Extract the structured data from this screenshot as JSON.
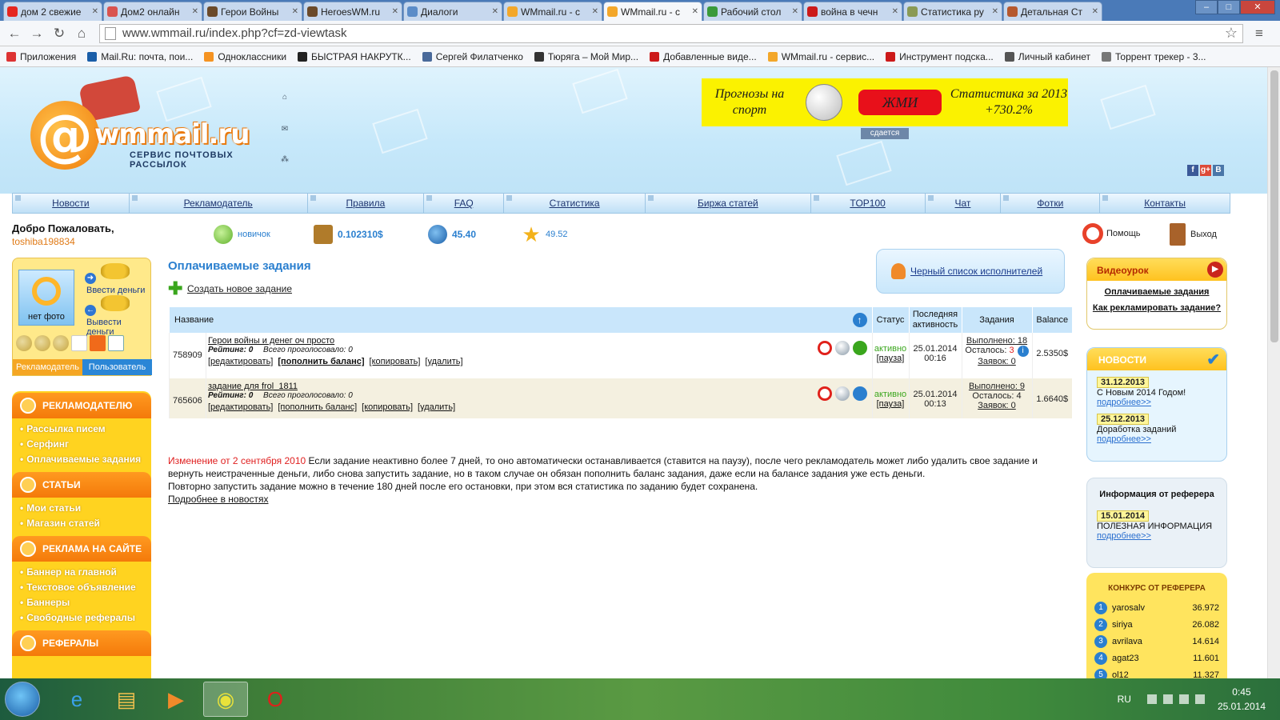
{
  "browser": {
    "tabs": [
      {
        "title": "дом 2 свежие",
        "color": "#e52620"
      },
      {
        "title": "Дом2 онлайн",
        "color": "#d9534f"
      },
      {
        "title": "Герои Войны",
        "color": "#6b4a2a"
      },
      {
        "title": "HeroesWM.ru",
        "color": "#6b4a2a"
      },
      {
        "title": "Диалоги",
        "color": "#5b8cc8"
      },
      {
        "title": "WMmail.ru - с",
        "color": "#f3a72a"
      },
      {
        "title": "WMmail.ru - с",
        "color": "#f3a72a",
        "active": true
      },
      {
        "title": "Рабочий стол",
        "color": "#3a9a3a"
      },
      {
        "title": "война в чечн",
        "color": "#cc1a1a"
      },
      {
        "title": "Статистика ру",
        "color": "#8a9a55"
      },
      {
        "title": "Детальная Ст",
        "color": "#b5582e"
      }
    ],
    "window_controls": {
      "minimize": "–",
      "maximize": "□",
      "close": "✕"
    },
    "nav_icons": {
      "back": "←",
      "forward": "→",
      "reload": "↻",
      "home": "⌂",
      "star": "☆",
      "menu": "≡"
    },
    "url": "www.wmmail.ru/index.php?cf=zd-viewtask",
    "bookmarks": [
      {
        "label": "Приложения",
        "color": "#d33"
      },
      {
        "label": "Mail.Ru: почта, пои...",
        "color": "#1a5ea8"
      },
      {
        "label": "Одноклассники",
        "color": "#f59322"
      },
      {
        "label": "БЫСТРАЯ НАКРУТК...",
        "color": "#222"
      },
      {
        "label": "Сергей Филатченко",
        "color": "#4a6a9a"
      },
      {
        "label": "Тюряга – Мой Мир...",
        "color": "#333"
      },
      {
        "label": "Добавленные виде...",
        "color": "#cc1a1a"
      },
      {
        "label": "WMmail.ru - сервис...",
        "color": "#f3a72a"
      },
      {
        "label": "Инструмент подска...",
        "color": "#cc1a1a"
      },
      {
        "label": "Личный кабинет",
        "color": "#555"
      },
      {
        "label": "Торрент трекер - 3...",
        "color": "#777"
      }
    ]
  },
  "header": {
    "logo_at": "@",
    "logo_name": "wmmail.ru",
    "logo_sub": "СЕРВИС ПОЧТОВЫХ РАССЫЛОК",
    "banner_left": "Прогнозы на спорт",
    "banner_button": "ЖМИ",
    "banner_right": "Статистика за 2013 +730.2%",
    "rent_label": "сдается",
    "social": [
      {
        "name": "facebook",
        "glyph": "f",
        "color": "#3b5998"
      },
      {
        "name": "google-plus",
        "glyph": "g+",
        "color": "#dd4b39"
      },
      {
        "name": "vkontakte",
        "glyph": "B",
        "color": "#4a76a8"
      }
    ]
  },
  "nav": [
    {
      "label": "Новости",
      "w": 146
    },
    {
      "label": "Рекламодатель",
      "w": 223
    },
    {
      "label": "Правила",
      "w": 146
    },
    {
      "label": "FAQ",
      "w": 100
    },
    {
      "label": "Статистика",
      "w": 177
    },
    {
      "label": "Биржа статей",
      "w": 207
    },
    {
      "label": "TOP100",
      "w": 143
    },
    {
      "label": "Чат",
      "w": 95
    },
    {
      "label": "Фотки",
      "w": 124
    },
    {
      "label": "Контакты",
      "w": 162
    }
  ],
  "user": {
    "welcome": "Добро Пожаловать,",
    "username": "toshiba198834",
    "level": "новичок",
    "balance": "0.102310$",
    "credit": "45.40",
    "rating": "49.52",
    "help": "Помощь",
    "logout": "Выход"
  },
  "profile": {
    "photo_label": "нет фото",
    "deposit": "Ввести деньги",
    "withdraw": "Вывести деньги",
    "role_advertiser": "Рекламодатель",
    "role_user": "Пользователь"
  },
  "left_menu": [
    {
      "title": "РЕКЛАМОДАТЕЛЮ",
      "items": [
        "Рассылка писем",
        "Серфинг",
        "Оплачиваемые задания"
      ]
    },
    {
      "title": "СТАТЬИ",
      "items": [
        "Мои статьи",
        "Магазин статей"
      ]
    },
    {
      "title": "РЕКЛАМА НА САЙТЕ",
      "items": [
        "Баннер на главной",
        "Текстовое объявление",
        "Баннеры",
        "Свободные рефералы"
      ]
    },
    {
      "title": "РЕФЕРАЛЫ",
      "items": []
    }
  ],
  "main": {
    "title": "Оплачиваемые задания",
    "create": "Создать новое задание",
    "blacklist": "Черный список исполнителей",
    "table": {
      "headers": {
        "name": "Название",
        "status": "Статус",
        "activity": "Последняя активность",
        "tasks": "Задания",
        "balance": "Balance"
      },
      "rows": [
        {
          "id": "758909",
          "name": "Герои войны и денег оч просто",
          "rating_label": "Рейтинг:",
          "rating": "0",
          "votes": "Всего проголосовало: 0",
          "actions": [
            "[редактировать]",
            "[пополнить баланс]",
            "[копировать]",
            "[удалить]"
          ],
          "status": "активно",
          "pause": "[пауза]",
          "date": "25.01.2014",
          "time": "00:16",
          "done": "Выполнено: 18",
          "left_label": "Осталось:",
          "left": "3",
          "requests": "Заявок: 0",
          "balance": "2.5350$"
        },
        {
          "id": "765606",
          "name": "задание для frol_1811",
          "rating_label": "Рейтинг:",
          "rating": "0",
          "votes": "Всего проголосовало: 0",
          "actions": [
            "[редактировать]",
            "[пополнить баланс]",
            "[копировать]",
            "[удалить]"
          ],
          "status": "активно",
          "pause": "[пауза]",
          "date": "25.01.2014",
          "time": "00:13",
          "done": "Выполнено: 9",
          "left_label": "Осталось:",
          "left": "4",
          "requests": "Заявок: 0",
          "balance": "1.6640$"
        }
      ]
    },
    "notice_date": "Изменение от 2 сентября 2010",
    "notice_text": " Если задание неактивно более 7 дней, то оно автоматически останавливается (ставится на паузу), после чего рекламодатель может либо удалить свое задание и вернуть неистраченные деньги, либо снова запустить задание, но в таком случае он обязан пополнить баланс задания, даже если на балансе задания уже есть деньги.",
    "notice_text2": "Повторно запустить задание можно в течение 180 дней после его остановки, при этом вся статистика по заданию будет сохранена.",
    "notice_more": "Подробнее в новостях"
  },
  "right": {
    "video_title": "Видеоурок",
    "video_links": [
      "Оплачиваемые задания",
      "Как рекламировать задание?"
    ],
    "news_title": "НОВОСТИ",
    "news": [
      {
        "date": "31.12.2013",
        "text": "С Новым 2014 Годом!",
        "more": "подробнее>>"
      },
      {
        "date": "25.12.2013",
        "text": "Доработка заданий",
        "more": "подробнее>>"
      }
    ],
    "ref_title": "Информация от реферера",
    "ref_date": "15.01.2014",
    "ref_text": "ПОЛЕЗНАЯ ИНФОРМАЦИЯ",
    "ref_more": "подробнее>>",
    "contest_title": "КОНКУРС ОТ РЕФЕРЕРА",
    "contest": [
      {
        "n": "1",
        "name": "yarosalv",
        "value": "36.972"
      },
      {
        "n": "2",
        "name": "siriya",
        "value": "26.082"
      },
      {
        "n": "3",
        "name": "avrilava",
        "value": "14.614"
      },
      {
        "n": "4",
        "name": "agat23",
        "value": "11.601"
      },
      {
        "n": "5",
        "name": "ol12",
        "value": "11.327"
      }
    ]
  },
  "taskbar": {
    "apps": [
      {
        "name": "internet-explorer-app",
        "glyph": "e",
        "color": "#3aa0e8"
      },
      {
        "name": "file-explorer-app",
        "glyph": "▤",
        "color": "#f2c14e"
      },
      {
        "name": "media-player-app",
        "glyph": "▶",
        "color": "#f08a2a"
      },
      {
        "name": "chrome-app",
        "glyph": "◉",
        "color": "#e8e23a",
        "active": true
      },
      {
        "name": "opera-app",
        "glyph": "O",
        "color": "#e0201a"
      }
    ],
    "lang": "RU",
    "time": "0:45",
    "date": "25.01.2014"
  }
}
